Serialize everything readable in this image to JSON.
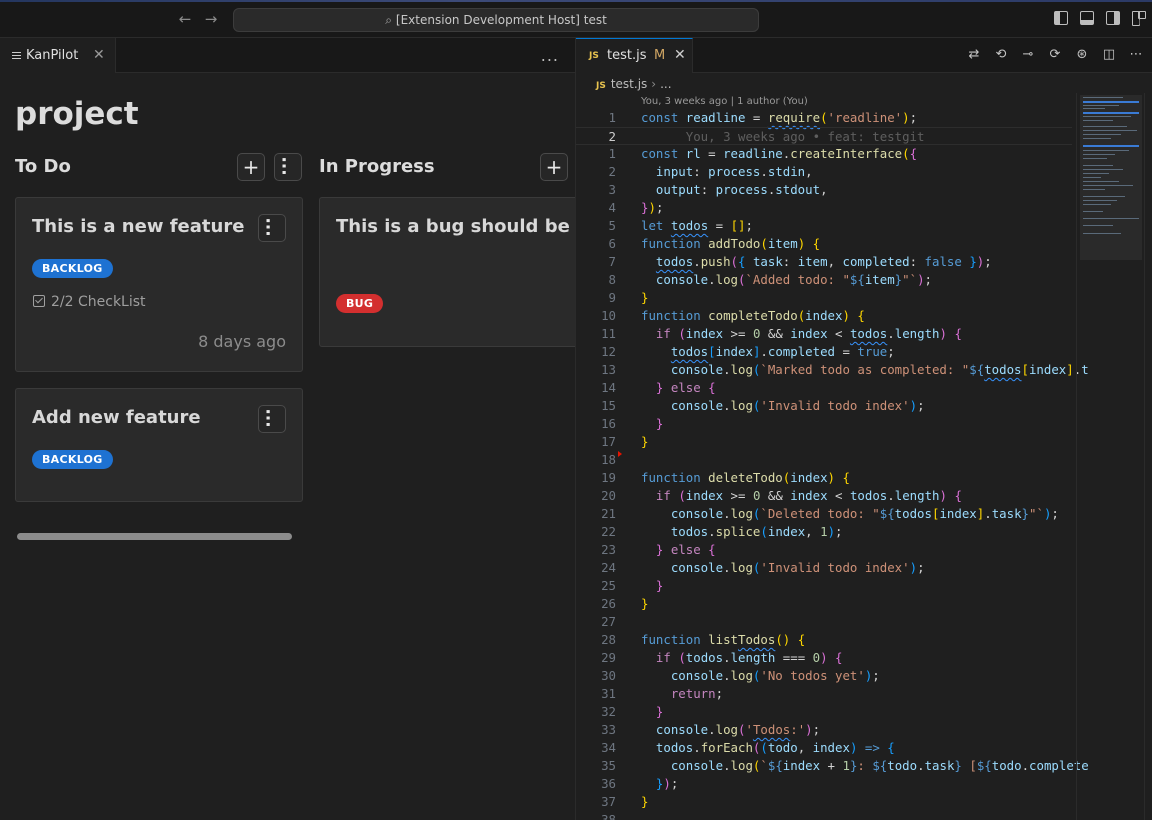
{
  "window": {
    "command_center": "[Extension Development Host] test"
  },
  "left_panel": {
    "tab_label": "KanPilot",
    "board_title": "project",
    "columns": [
      {
        "title": "To Do",
        "cards": [
          {
            "title": "This is a new feature",
            "badge": "BACKLOG",
            "checklist": "2/2 CheckList",
            "age": "8 days ago"
          },
          {
            "title": "Add new feature",
            "badge": "BACKLOG"
          }
        ]
      },
      {
        "title": "In Progress",
        "cards": [
          {
            "title": "This is a bug should be rep",
            "badge": "BUG"
          }
        ]
      }
    ],
    "add_symbol": "+",
    "more_symbol": "..."
  },
  "editor": {
    "tab": {
      "lang_icon": "JS",
      "file": "test.js",
      "status": "M"
    },
    "breadcrumb": {
      "file": "test.js",
      "more": "..."
    },
    "blame_top": "You, 3 weeks ago | 1 author (You)",
    "ghost_blame": "You, 3 weeks ago • feat: testgit",
    "line_numbers": [
      "1",
      "2",
      "1",
      "2",
      "3",
      "4",
      "5",
      "6",
      "7",
      "8",
      "9",
      "10",
      "11",
      "12",
      "13",
      "14",
      "15",
      "16",
      "17",
      "18",
      "19",
      "20",
      "21",
      "22",
      "23",
      "24",
      "25",
      "26",
      "27",
      "28",
      "29",
      "30",
      "31",
      "32",
      "33",
      "34",
      "35",
      "36",
      "37",
      "38"
    ]
  },
  "colors": {
    "accent": "#0078d4",
    "badge_backlog": "#1e72d2",
    "badge_bug": "#d32f2f",
    "modified": "#d1a664"
  },
  "icons": [
    "search-icon",
    "arrow-left-icon",
    "arrow-right-icon",
    "toggle-sidebar-icon",
    "toggle-panel-icon",
    "toggle-secondary-sidebar-icon",
    "customize-layout-icon",
    "close-icon",
    "more-icon",
    "plus-icon",
    "kebab-icon",
    "checklist-icon",
    "compare-changes-icon",
    "go-back-icon",
    "git-commit-icon",
    "go-forward-icon",
    "copilot-icon",
    "split-editor-icon"
  ]
}
